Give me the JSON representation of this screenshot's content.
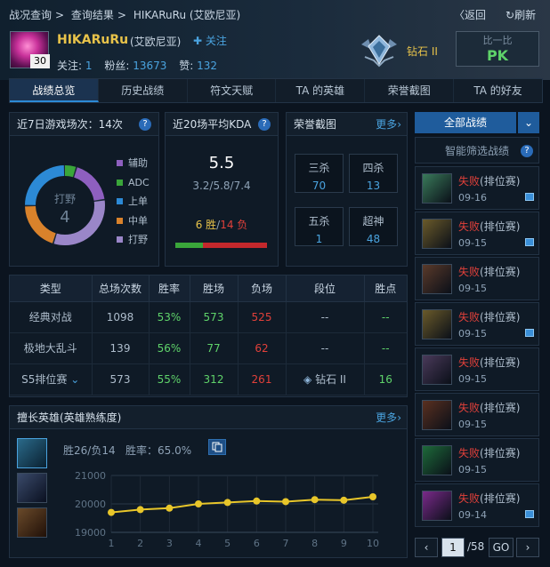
{
  "breadcrumb": {
    "root": "战况查询",
    "sep": ">",
    "results": "查询结果",
    "current": "HIKARuRu (艾欧尼亚)"
  },
  "nav": {
    "back_label": "返回",
    "refresh_label": "刷新"
  },
  "player": {
    "level": "30",
    "name": "HIKARuRu",
    "server": "(艾欧尼亚)",
    "follow_label": "关注",
    "following_label": "关注:",
    "following": "1",
    "fans_label": "粉丝:",
    "fans": "13673",
    "likes_label": "赞:",
    "likes": "132",
    "rank": "钻石 II"
  },
  "pk": {
    "label": "比一比",
    "text": "PK"
  },
  "tabs": [
    "战绩总览",
    "历史战绩",
    "符文天赋",
    "TA 的英雄",
    "荣誉截图",
    "TA 的好友"
  ],
  "games7d": {
    "title": "近7日游戏场次：14次",
    "center_label": "打野",
    "center_value": "4",
    "legend": [
      "辅助",
      "ADC",
      "上单",
      "中单",
      "打野"
    ],
    "legend_colors": [
      "#8e5fbf",
      "#3aa63a",
      "#2c8ad6",
      "#d9822b",
      "#9a86c8"
    ]
  },
  "kda": {
    "title": "近20场平均KDA",
    "value": "5.5",
    "detail": "3.2/5.8/7.4",
    "wins": "6 胜",
    "sep": "/",
    "losses": "14 负",
    "win_fraction": 0.3
  },
  "honor": {
    "title": "荣誉截图",
    "more": "更多",
    "items": [
      {
        "label": "三杀",
        "value": "70"
      },
      {
        "label": "四杀",
        "value": "13"
      },
      {
        "label": "五杀",
        "value": "1"
      },
      {
        "label": "超神",
        "value": "48"
      }
    ]
  },
  "table": {
    "headers": [
      "类型",
      "总场次数",
      "胜率",
      "胜场",
      "负场",
      "段位",
      "胜点"
    ],
    "rows": [
      {
        "type": "经典对战",
        "total": "1098",
        "rate": "53%",
        "win": "573",
        "lose": "525",
        "tier": "--",
        "lp": "--"
      },
      {
        "type": "极地大乱斗",
        "total": "139",
        "rate": "56%",
        "win": "77",
        "lose": "62",
        "tier": "--",
        "lp": "--"
      },
      {
        "type": "S5排位赛",
        "total": "573",
        "rate": "55%",
        "win": "312",
        "lose": "261",
        "tier": "钻石 II",
        "lp": "16"
      }
    ]
  },
  "champs": {
    "title": "擅长英雄(英雄熟练度)",
    "more": "更多",
    "stat_wl": "胜26/负14",
    "stat_rate": "胜率：65.0%"
  },
  "chart_data": {
    "type": "line",
    "x": [
      1,
      2,
      3,
      4,
      5,
      6,
      7,
      8,
      9,
      10
    ],
    "y": [
      19700,
      19800,
      19850,
      20000,
      20050,
      20100,
      20080,
      20150,
      20130,
      20250
    ],
    "ylim": [
      19000,
      21000
    ],
    "yticks": [
      19000,
      20000,
      21000
    ],
    "line_color": "#e8c62a"
  },
  "recent": {
    "all_label": "全部战绩",
    "smart_label": "智能筛选战绩",
    "matches": [
      {
        "result": "失败",
        "mode": "(排位赛)",
        "date": "09-16",
        "icon_color": "#3a7a5a",
        "flag": true
      },
      {
        "result": "失败",
        "mode": "(排位赛)",
        "date": "09-15",
        "icon_color": "#6a5a2a",
        "flag": true
      },
      {
        "result": "失败",
        "mode": "(排位赛)",
        "date": "09-15",
        "icon_color": "#5a3a2a",
        "flag": false
      },
      {
        "result": "失败",
        "mode": "(排位赛)",
        "date": "09-15",
        "icon_color": "#6a5a2a",
        "flag": true
      },
      {
        "result": "失败",
        "mode": "(排位赛)",
        "date": "09-15",
        "icon_color": "#4a3a5a",
        "flag": false
      },
      {
        "result": "失败",
        "mode": "(排位赛)",
        "date": "09-15",
        "icon_color": "#5a3020",
        "flag": false
      },
      {
        "result": "失败",
        "mode": "(排位赛)",
        "date": "09-15",
        "icon_color": "#1e6a3a",
        "flag": false
      },
      {
        "result": "失败",
        "mode": "(排位赛)",
        "date": "09-14",
        "icon_color": "#7a2a8a",
        "flag": true
      }
    ]
  },
  "pager": {
    "current": "1",
    "total": "/58",
    "go": "GO"
  }
}
